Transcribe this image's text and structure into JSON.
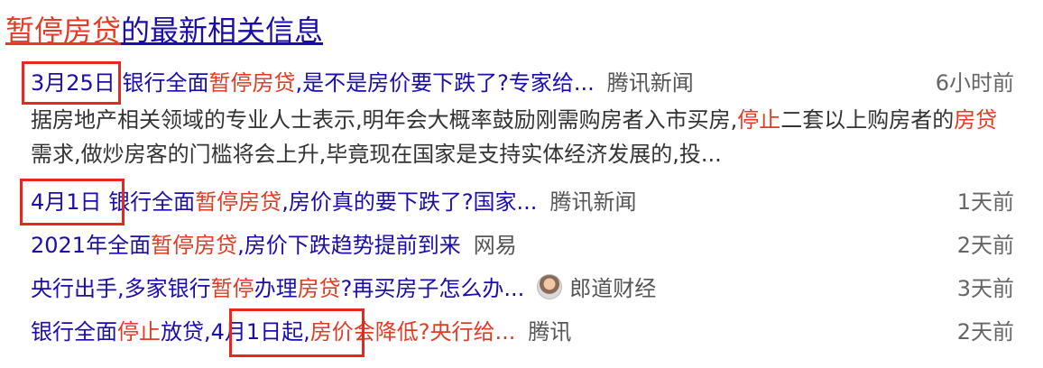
{
  "heading": {
    "hl": "暂停房贷",
    "rest": "的最新相关信息"
  },
  "results": [
    {
      "date": "3月25日",
      "t1": "银行全面",
      "h1": "暂停房贷",
      "t2": ",是不是房价要下跌了?专家给...",
      "source": "腾讯新闻",
      "time": "6小时前",
      "snippet": {
        "a": "据房地产相关领域的专业人士表示,明年会大概率鼓励刚需购房者入市买房,",
        "h1": "停止",
        "b": "二套以上购房者的",
        "h2": "房贷",
        "c": "需求,做炒房客的门槛将会上升,毕竟现在国家是支持实体经济发展的,投..."
      }
    },
    {
      "date": "4月1日",
      "t1": "银行全面",
      "h1": "暂停房贷",
      "t2": ",房价真的要下跌了?国家...",
      "source": "腾讯新闻",
      "time": "1天前"
    },
    {
      "t1": "2021年全面",
      "h1": "暂停房贷",
      "t2": ",房价下跌趋势提前到来",
      "source": "网易",
      "time": "2天前"
    },
    {
      "t1": "央行出手,多家银行",
      "h1": "暂停",
      "t2": "办理",
      "h2": "房贷",
      "t3": "?再买房子怎么办...",
      "source": "郎道财经",
      "source_icon": "avatar-icon",
      "time": "3天前"
    },
    {
      "t1": "银行全面",
      "h1": "停止",
      "t2": "放贷",
      "t3": ",4月1日起,",
      "t4": "房价会降低?央行给...",
      "source": "腾讯",
      "time": "2天前"
    }
  ],
  "colors": {
    "link": "#1a0dab",
    "highlight": "#e43b24",
    "box": "#e8271f",
    "text": "#333333",
    "meta": "#666666"
  }
}
